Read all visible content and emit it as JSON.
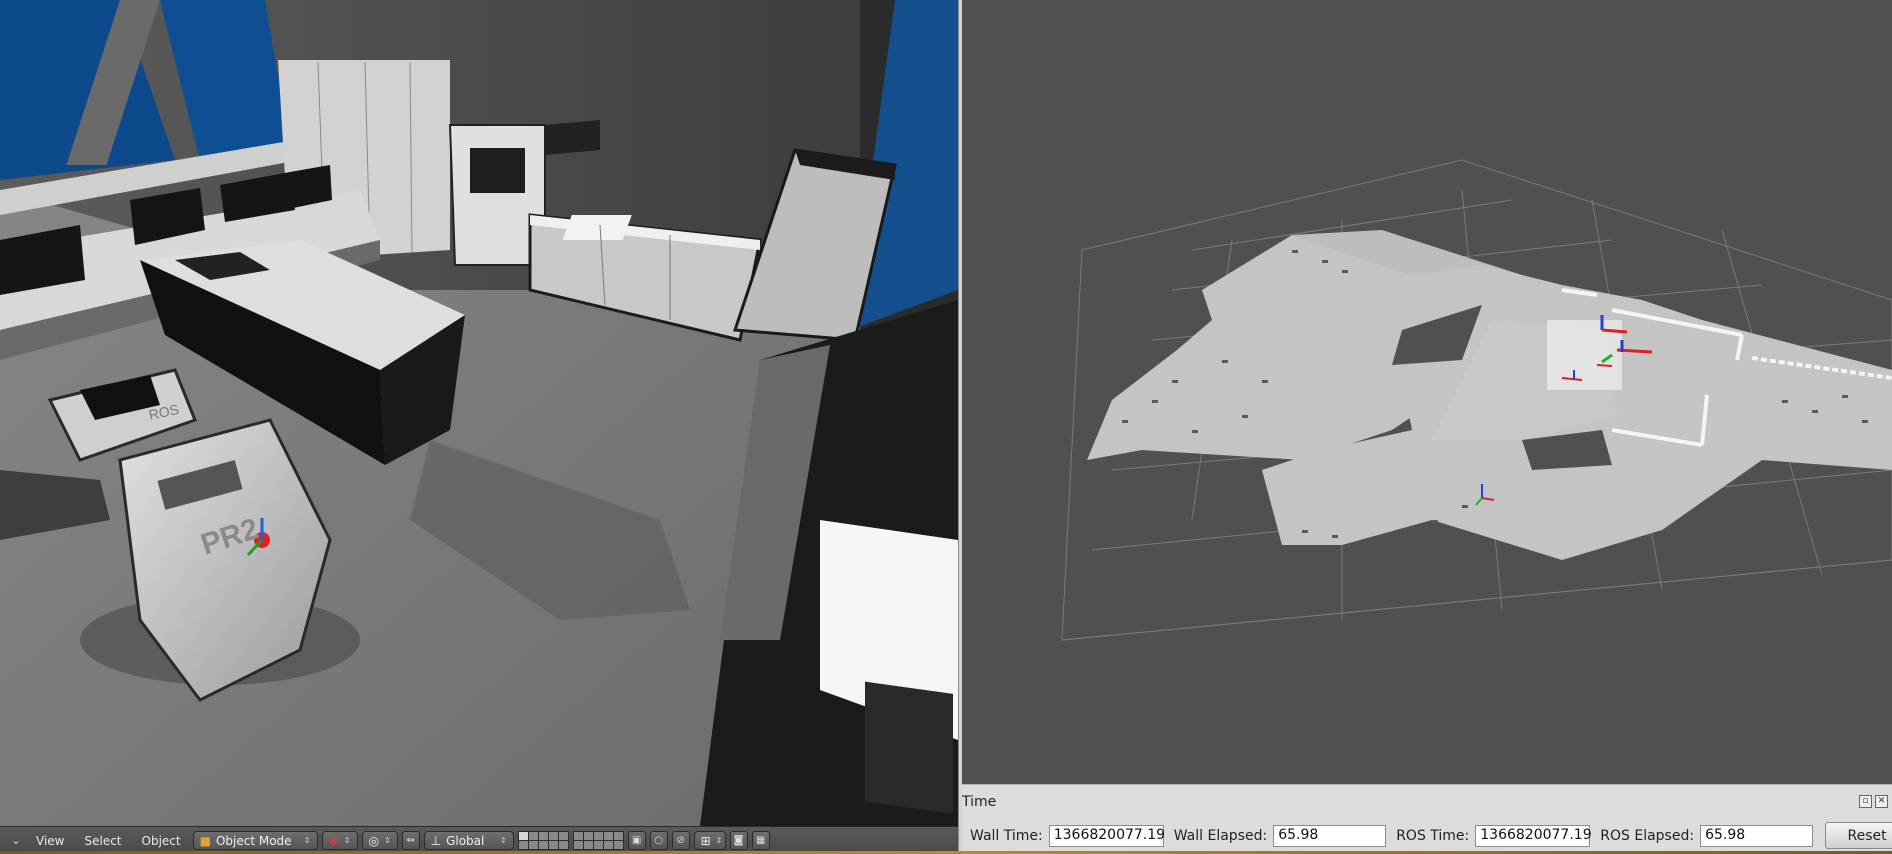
{
  "blender": {
    "menu": [
      "View",
      "Select",
      "Object"
    ],
    "mode_dropdown": "Object Mode",
    "orientation_dropdown": "Global",
    "robot_label": "PR2",
    "robot_head_label": "ROS"
  },
  "rviz": {
    "time_panel": {
      "title": "Time",
      "wall_time_label": "Wall Time:",
      "wall_time_value": "1366820077.19",
      "wall_elapsed_label": "Wall Elapsed:",
      "wall_elapsed_value": "65.98",
      "ros_time_label": "ROS Time:",
      "ros_time_value": "1366820077.19",
      "ros_elapsed_label": "ROS Elapsed:",
      "ros_elapsed_value": "65.98",
      "reset_label": "Reset"
    }
  },
  "colors": {
    "rviz_background": "#505050",
    "map_free": "#c4c4c4",
    "window_blue": "#0d4a8c"
  }
}
